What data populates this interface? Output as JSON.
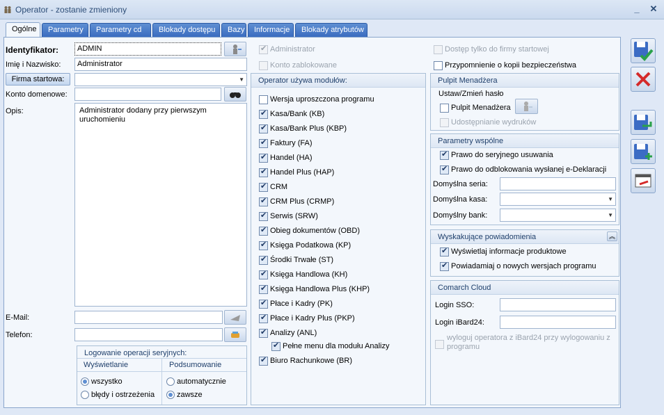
{
  "window": {
    "title": "Operator - zostanie zmieniony",
    "min": "_",
    "close": "✕"
  },
  "tabs": [
    {
      "label": "Ogólne"
    },
    {
      "label": "Parametry"
    },
    {
      "label": "Parametry cd"
    },
    {
      "label": "Blokady dostępu"
    },
    {
      "label": "Bazy"
    },
    {
      "label": "Informacje"
    },
    {
      "label": "Blokady atrybutów"
    }
  ],
  "left": {
    "identyfikator_label": "Identyfikator:",
    "identyfikator_value": "ADMIN",
    "imie_label": "Imię i Nazwisko:",
    "imie_value": "Administrator",
    "firma_label": "Firma startowa:",
    "firma_value": "",
    "konto_label": "Konto domenowe:",
    "konto_value": "",
    "opis_label": "Opis:",
    "opis_value": "Administrator dodany przy pierwszym uruchomieniu",
    "email_label": "E-Mail:",
    "email_value": "",
    "telefon_label": "Telefon:",
    "telefon_value": ""
  },
  "logowanie": {
    "title": "Logowanie operacji seryjnych:",
    "col1": "Wyświetlanie",
    "col2": "Podsumowanie",
    "opt_wszystko": "wszystko",
    "opt_bledy": "błędy i ostrzeżenia",
    "opt_auto": "automatycznie",
    "opt_zawsze": "zawsze"
  },
  "top_checks": {
    "administrator": "Administrator",
    "konto_zablokowane": "Konto zablokowane",
    "dostep": "Dostęp tylko do firmy startowej",
    "przypomnienie": "Przypomnienie o kopii bezpieczeństwa"
  },
  "modules": {
    "title": "Operator używa modułów:",
    "items": [
      {
        "label": "Wersja uproszczona programu",
        "checked": false
      },
      {
        "label": "Kasa/Bank (KB)",
        "checked": true
      },
      {
        "label": "Kasa/Bank Plus (KBP)",
        "checked": true
      },
      {
        "label": "Faktury (FA)",
        "checked": true
      },
      {
        "label": "Handel (HA)",
        "checked": true
      },
      {
        "label": "Handel Plus (HAP)",
        "checked": true
      },
      {
        "label": "CRM",
        "checked": true
      },
      {
        "label": "CRM Plus (CRMP)",
        "checked": true
      },
      {
        "label": "Serwis (SRW)",
        "checked": true
      },
      {
        "label": "Obieg dokumentów (OBD)",
        "checked": true
      },
      {
        "label": "Księga Podatkowa (KP)",
        "checked": true
      },
      {
        "label": "Środki Trwałe (ST)",
        "checked": true
      },
      {
        "label": "Księga Handlowa (KH)",
        "checked": true
      },
      {
        "label": "Księga Handlowa Plus (KHP)",
        "checked": true
      },
      {
        "label": "Płace i Kadry (PK)",
        "checked": true
      },
      {
        "label": "Płace i Kadry Plus (PKP)",
        "checked": true
      },
      {
        "label": "Analizy (ANL)",
        "checked": true
      }
    ],
    "pelne_menu": "Pełne menu dla modułu Analizy",
    "biuro": "Biuro Rachunkowe (BR)"
  },
  "pulpit": {
    "title": "Pulpit Menadżera",
    "ustaw": "Ustaw/Zmień hasło",
    "pulpit_cb": "Pulpit Menadżera",
    "udostepnianie": "Udostępnianie wydruków"
  },
  "parametry": {
    "title": "Parametry wspólne",
    "prawo1": "Prawo do seryjnego usuwania",
    "prawo2": "Prawo do odblokowania wysłanej e-Deklaracji",
    "seria_label": "Domyślna seria:",
    "kasa_label": "Domyślna kasa:",
    "bank_label": "Domyślny bank:"
  },
  "powiadomienia": {
    "title": "Wyskakujące powiadomienia",
    "opt1": "Wyświetlaj informacje produktowe",
    "opt2": "Powiadamiaj o nowych wersjach programu"
  },
  "cloud": {
    "title": "Comarch Cloud",
    "login_sso": "Login SSO:",
    "login_ibard": "Login iBard24:",
    "wyloguj_1": "wyloguj operatora z iBard24 przy wylogowaniu z",
    "wyloguj_2": "programu"
  }
}
